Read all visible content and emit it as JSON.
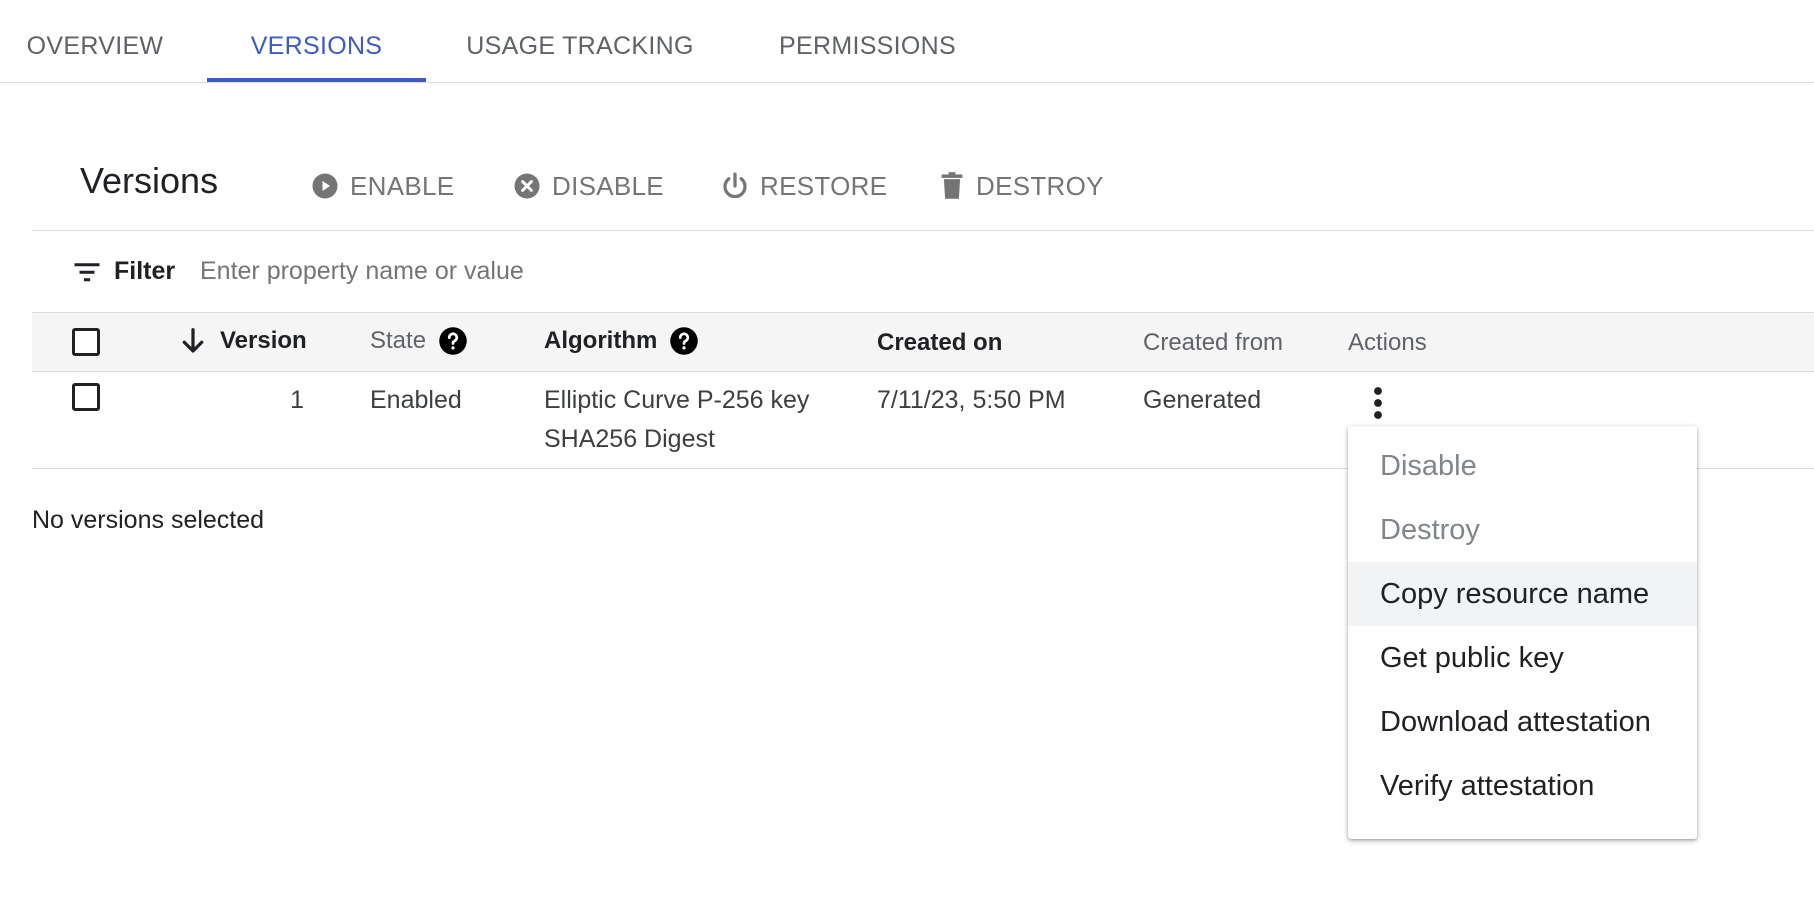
{
  "tabs": [
    {
      "label": "OVERVIEW"
    },
    {
      "label": "VERSIONS"
    },
    {
      "label": "USAGE TRACKING"
    },
    {
      "label": "PERMISSIONS"
    }
  ],
  "toolbar": {
    "title": "Versions",
    "enable_label": "ENABLE",
    "disable_label": "DISABLE",
    "restore_label": "RESTORE",
    "destroy_label": "DESTROY"
  },
  "filter": {
    "label": "Filter",
    "placeholder": "Enter property name or value"
  },
  "table": {
    "headers": {
      "version": "Version",
      "state": "State",
      "algorithm": "Algorithm",
      "created_on": "Created on",
      "created_from": "Created from",
      "actions": "Actions"
    },
    "rows": [
      {
        "version": "1",
        "state": "Enabled",
        "algorithm_line1": "Elliptic Curve P-256 key",
        "algorithm_line2": "SHA256 Digest",
        "created_on": "7/11/23, 5:50 PM",
        "created_from": "Generated"
      }
    ]
  },
  "selection_status": "No versions selected",
  "menu": {
    "items": [
      {
        "label": "Disable",
        "enabled": false
      },
      {
        "label": "Destroy",
        "enabled": false
      },
      {
        "label": "Copy resource name",
        "enabled": true
      },
      {
        "label": "Get public key",
        "enabled": true
      },
      {
        "label": "Download attestation",
        "enabled": true
      },
      {
        "label": "Verify attestation",
        "enabled": true
      }
    ]
  },
  "colors": {
    "accent": "#3c5bc8",
    "muted": "#757575"
  }
}
